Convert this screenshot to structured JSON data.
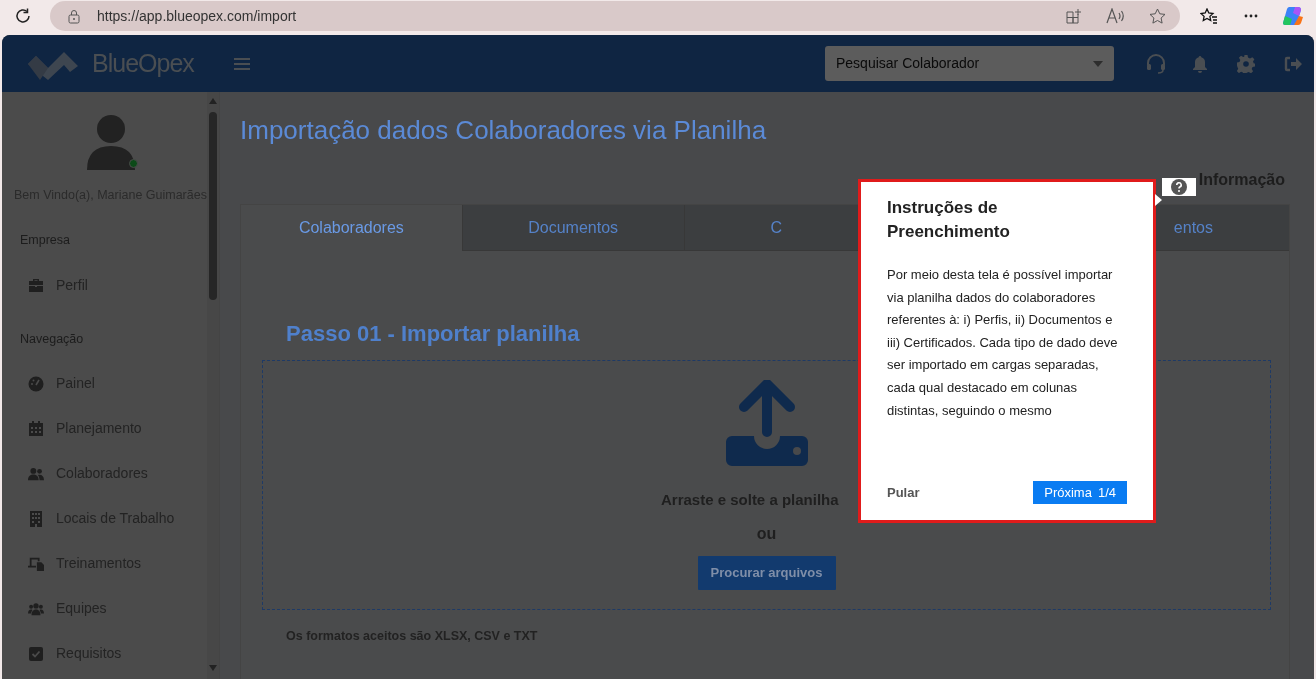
{
  "browser": {
    "url": "https://app.blueopex.com/import"
  },
  "header": {
    "logo": "BlueOpex",
    "search": {
      "placeholder": "Pesquisar Colaborador"
    }
  },
  "sidebar": {
    "greeting": "Bem Vindo(a), Mariane Guimarães",
    "online": true,
    "sections": [
      {
        "title": "Empresa",
        "items": [
          {
            "label": "Perfil"
          }
        ]
      },
      {
        "title": "Navegação",
        "items": [
          {
            "label": "Painel"
          },
          {
            "label": "Planejamento"
          },
          {
            "label": "Colaboradores"
          },
          {
            "label": "Locais de Trabalho"
          },
          {
            "label": "Treinamentos"
          },
          {
            "label": "Equipes"
          },
          {
            "label": "Requisitos"
          }
        ]
      }
    ]
  },
  "main": {
    "title": "Importação dados Colaboradores via Planilha",
    "info_label": "Informação",
    "tabs": [
      {
        "label": "Colaboradores",
        "selected": true
      },
      {
        "label": "Documentos",
        "selected": false
      },
      {
        "label": "C",
        "selected": false
      },
      {
        "label": "entos",
        "selected": false
      }
    ],
    "step_title": "Passo 01 - Importar planilha",
    "drop_text": "Arraste e solte a planilha",
    "or_text": "ou",
    "browse_button": "Procurar arquivos",
    "formats_note": "Os formatos aceitos são XLSX, CSV e TXT"
  },
  "popover": {
    "title": "Instruções de Preenchimento",
    "body": "Por meio desta tela é possível importar via planilha dados do colaboradores referentes à: i) Perfis, ii) Documentos e iii) Certificados. Cada tipo de dado deve ser importado em cargas separadas, cada qual destacado em colunas distintas, seguindo o mesmo",
    "skip": "Pular",
    "next": "Próxima",
    "step": "1/4"
  }
}
